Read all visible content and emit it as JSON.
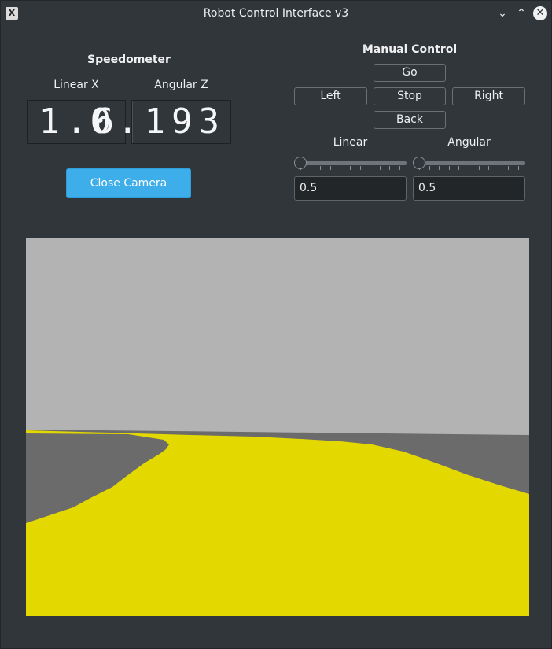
{
  "window": {
    "title": "Robot Control Interface v3",
    "icon": "app-x-icon",
    "controls": [
      "minimize-icon",
      "maximize-icon",
      "close-icon"
    ]
  },
  "speedometer": {
    "title": "Speedometer",
    "linear_label": "Linear X",
    "angular_label": "Angular Z",
    "linear_value": "1.6",
    "angular_value": "0.193"
  },
  "camera_button": {
    "label": "Close Camera"
  },
  "manual_control": {
    "title": "Manual Control",
    "go": "Go",
    "left": "Left",
    "stop": "Stop",
    "right": "Right",
    "back": "Back",
    "linear_label": "Linear",
    "angular_label": "Angular",
    "linear_slider_value": 0,
    "angular_slider_value": 0,
    "linear_input": "0.5",
    "angular_input": "0.5"
  },
  "colors": {
    "accent": "#3daee9",
    "background": "#31363b",
    "sky": "#b3b3b3",
    "ground": "#6b6b6b",
    "lane": "#e3d800"
  }
}
